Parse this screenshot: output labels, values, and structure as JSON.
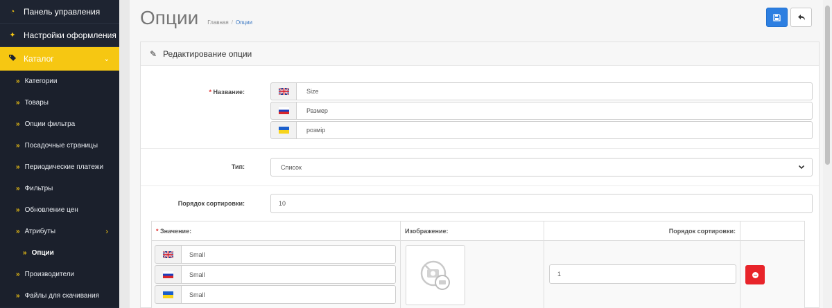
{
  "sidebar": {
    "top_items": [
      {
        "label": "Панель управления",
        "icon": "dashboard-icon"
      },
      {
        "label": "Настройки оформления",
        "icon": "magic-wand-icon"
      }
    ],
    "catalog": {
      "label": "Каталог",
      "icon": "tags-icon",
      "chevron": "chevron-down-icon"
    },
    "sub_items": [
      {
        "label": "Категории"
      },
      {
        "label": "Товары"
      },
      {
        "label": "Опции фильтра"
      },
      {
        "label": "Посадочные страницы"
      },
      {
        "label": "Периодические платежи"
      },
      {
        "label": "Фильтры"
      },
      {
        "label": "Обновление цен"
      },
      {
        "label": "Атрибуты"
      },
      {
        "label": "Опции"
      },
      {
        "label": "Производители"
      },
      {
        "label": "Файлы для скачивания"
      }
    ],
    "accent_color": "#f6c712",
    "bg_color": "#1e2431"
  },
  "header": {
    "title": "Опции",
    "breadcrumb": [
      "Главная",
      "Опции"
    ],
    "breadcrumb_sep": "/"
  },
  "buttons": {
    "save_icon": "floppy-disk-icon",
    "back_icon": "reply-arrow-icon",
    "save_color": "#2d7fe1"
  },
  "card": {
    "title": "Редактирование опции",
    "icon": "pencil-icon"
  },
  "form": {
    "name": {
      "label": "Название:",
      "required_mark": "*",
      "values": [
        {
          "lang": "en",
          "flag": "uk-flag-icon",
          "value": "Size"
        },
        {
          "lang": "ru",
          "flag": "ru-flag-icon",
          "value": "Размер"
        },
        {
          "lang": "ua",
          "flag": "ua-flag-icon",
          "value": "розмір"
        }
      ]
    },
    "type": {
      "label": "Тип:",
      "selected": "Список"
    },
    "sort_order": {
      "label": "Порядок сортировки:",
      "value": "10"
    }
  },
  "values_table": {
    "headers": {
      "value": "Значение:",
      "value_required_mark": "*",
      "image": "Изображение:",
      "sort_order": "Порядок сортировки:"
    },
    "rows": [
      {
        "names": [
          {
            "lang": "en",
            "flag": "uk-flag-icon",
            "value": "Small"
          },
          {
            "lang": "ru",
            "flag": "ru-flag-icon",
            "value": "Small"
          },
          {
            "lang": "ua",
            "flag": "ua-flag-icon",
            "value": "Small"
          }
        ],
        "image": "no-image-placeholder-icon",
        "sort_order": "1",
        "remove_icon": "minus-circle-icon",
        "remove_color": "#e8242a"
      }
    ]
  }
}
